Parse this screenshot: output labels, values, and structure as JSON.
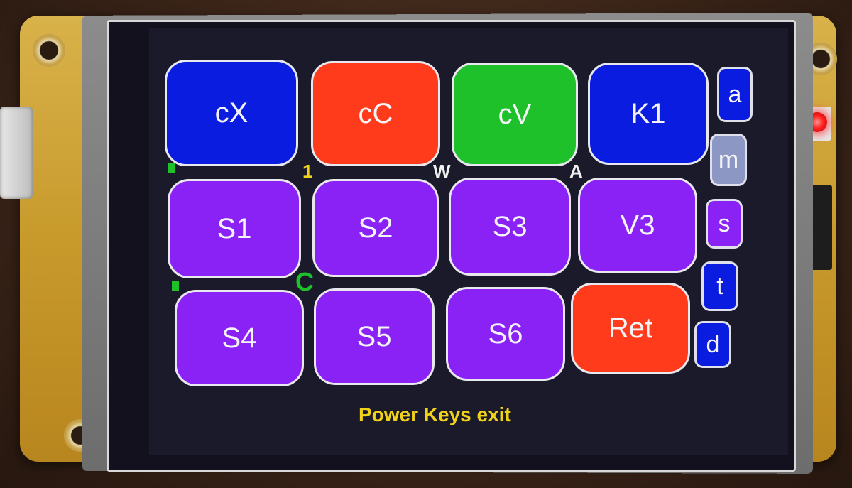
{
  "keys": {
    "row1": [
      {
        "label": "cX",
        "color": "#0a1ce0"
      },
      {
        "label": "cC",
        "color": "#ff3b1c"
      },
      {
        "label": "cV",
        "color": "#1ec12a"
      },
      {
        "label": "K1",
        "color": "#0a1ce0"
      }
    ],
    "row2": [
      {
        "label": "S1",
        "color": "#8a22f5"
      },
      {
        "label": "S2",
        "color": "#8a22f5"
      },
      {
        "label": "S3",
        "color": "#8a22f5"
      },
      {
        "label": "V3",
        "color": "#8a22f5"
      }
    ],
    "row3": [
      {
        "label": "S4",
        "color": "#8a22f5"
      },
      {
        "label": "S5",
        "color": "#8a22f5"
      },
      {
        "label": "S6",
        "color": "#8a22f5"
      },
      {
        "label": "Ret",
        "color": "#ff3b1c"
      }
    ]
  },
  "side_keys": [
    {
      "label": "a",
      "color": "#0a1ce0"
    },
    {
      "label": "m",
      "color": "#8c97c4"
    },
    {
      "label": "s",
      "color": "#8a22f5"
    },
    {
      "label": "t",
      "color": "#0a1ce0"
    },
    {
      "label": "d",
      "color": "#0a1ce0"
    }
  ],
  "indicators": {
    "one": "1",
    "w": "W",
    "a": "A",
    "c": "C"
  },
  "footer": {
    "message": "Power Keys exit"
  }
}
